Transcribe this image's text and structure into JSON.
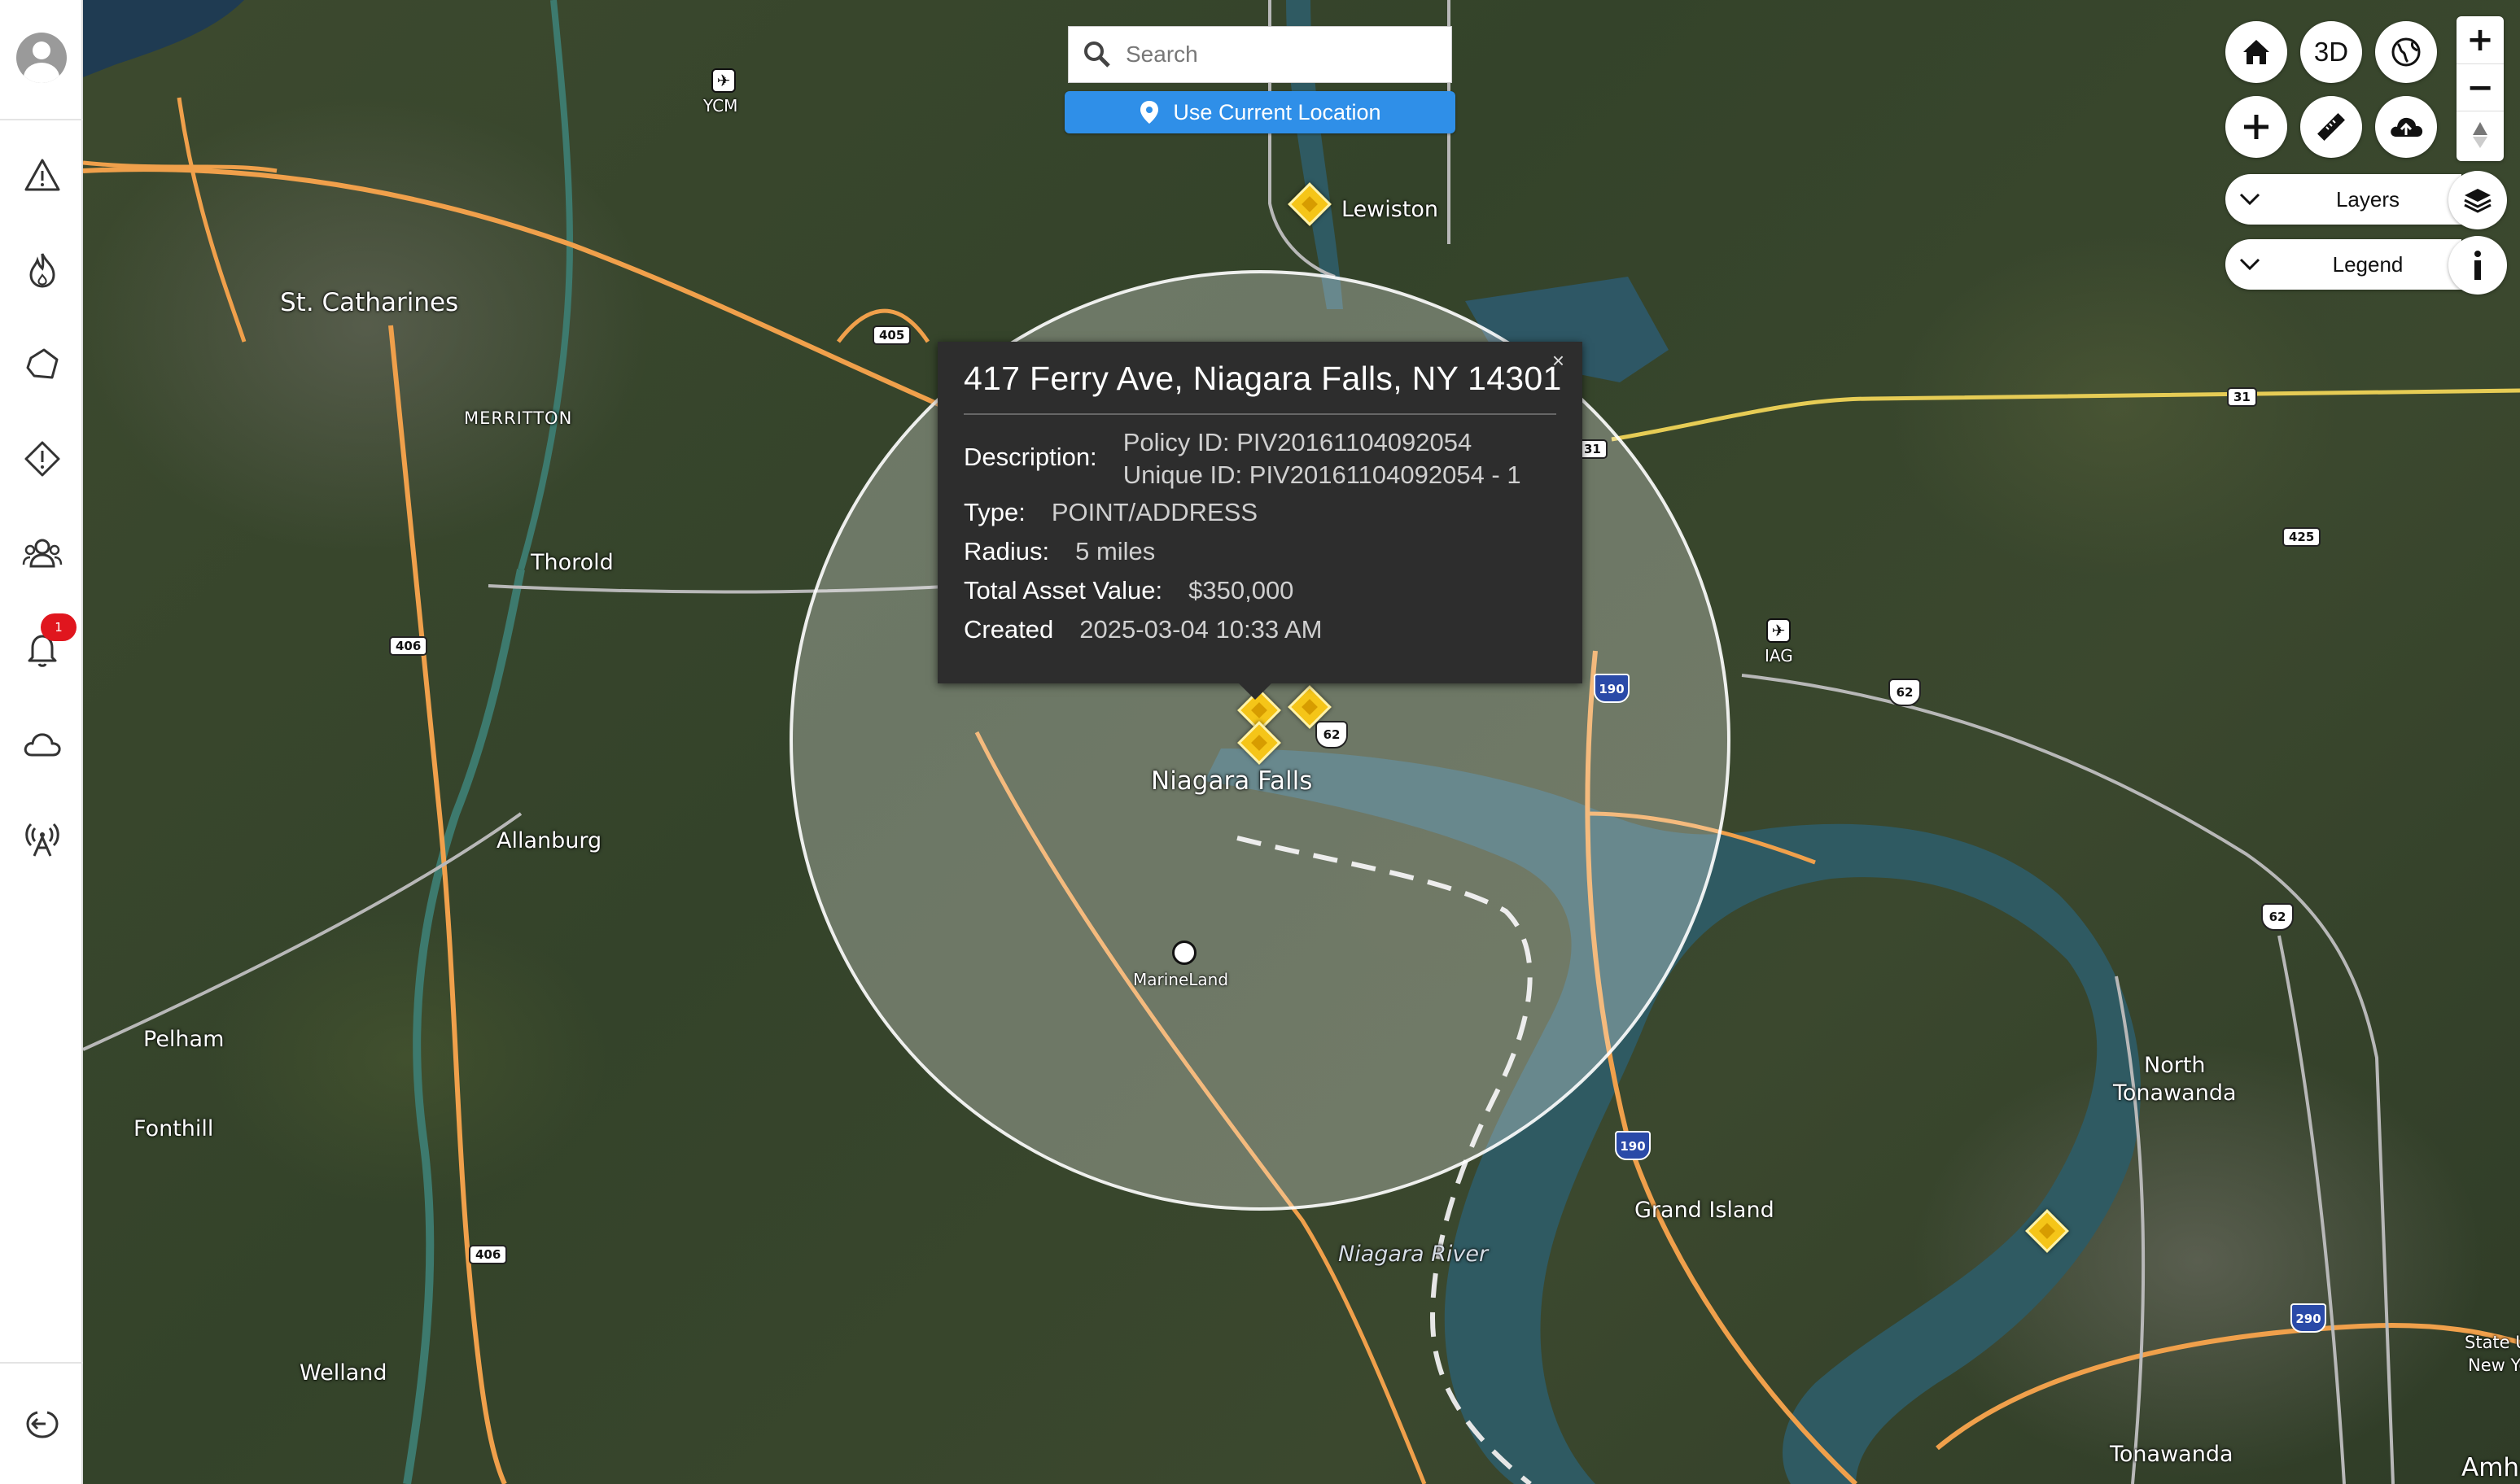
{
  "search": {
    "placeholder": "Search"
  },
  "locate_button": {
    "label": "Use Current Location"
  },
  "sidebar": {
    "badge_count": "1",
    "items": [
      {
        "name": "warning-icon"
      },
      {
        "name": "fire-icon"
      },
      {
        "name": "region-icon"
      },
      {
        "name": "alert-icon"
      },
      {
        "name": "group-icon"
      },
      {
        "name": "bell-icon"
      },
      {
        "name": "cloud-icon"
      },
      {
        "name": "antenna-icon"
      }
    ]
  },
  "controls": {
    "three_d_label": "3D",
    "zoom_in": "+",
    "zoom_out": "−",
    "layers_label": "Layers",
    "legend_label": "Legend"
  },
  "popup": {
    "title": "417 Ferry Ave, Niagara Falls, NY 14301",
    "close": "×",
    "description_label": "Description:",
    "description_line1": "Policy ID: PIV20161104092054",
    "description_line2": "Unique ID: PIV20161104092054 - 1",
    "type_label": "Type:",
    "type_value": "POINT/ADDRESS",
    "radius_label": "Radius:",
    "radius_value": "5 miles",
    "asset_label": "Total Asset Value:",
    "asset_value": "$350,000",
    "created_label": "Created",
    "created_value": "2025-03-04 10:33 AM"
  },
  "map": {
    "places": {
      "st_catharines": "St. Catharines",
      "merritton": "MERRITTON",
      "thorold": "Thorold",
      "allanburg": "Allanburg",
      "pelham": "Pelham",
      "fonthill": "Fonthill",
      "welland": "Welland",
      "lewiston": "Lewiston",
      "niagara_falls": "Niagara Falls",
      "marineland": "MarineLand",
      "niagara_river": "Niagara River",
      "grand_island": "Grand Island",
      "north_tonawanda_1": "North",
      "north_tonawanda_2": "Tonawanda",
      "tonawanda": "Tonawanda",
      "amherst": "Amher",
      "state_univ_1": "State U",
      "state_univ_2": "New Yo",
      "ycm": "YCM",
      "iag": "IAG"
    },
    "shields": {
      "r405": "405",
      "r406a": "406",
      "r406b": "406",
      "r31a": "31",
      "r31b": "31",
      "r425": "425",
      "i190a": "190",
      "i190b": "190",
      "i290": "290",
      "us62a": "62",
      "us62b": "62",
      "us62c": "62"
    },
    "colors": {
      "highway": "#f0a04b",
      "water": "#2f5a62",
      "radius_fill": "#ffffff",
      "marker": "#f5c518"
    }
  }
}
